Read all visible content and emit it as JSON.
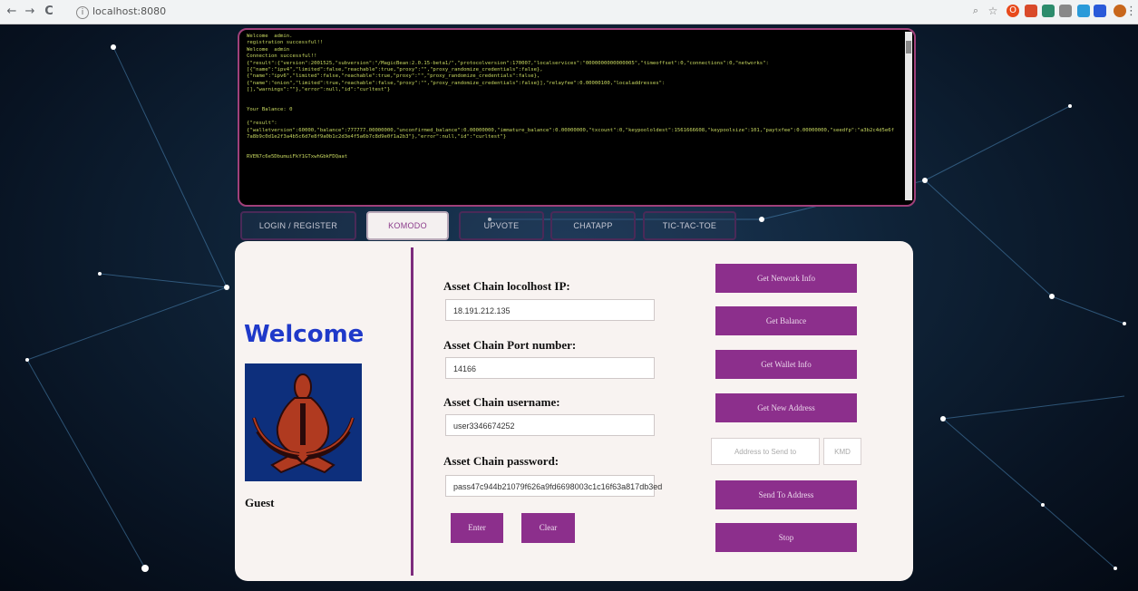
{
  "browser": {
    "url": "localhost:8080",
    "back_icon": "←",
    "forward_icon": "→",
    "reload_icon": "C"
  },
  "console": {
    "lines": "Welcome  admin.\nregistration successful!!\nWelcome  admin\nConnection successful!!\n{\"result\":{\"version\":2001525,\"subversion\":\"/MagicBean:2.0.15-beta1/\",\"protocolversion\":170007,\"localservices\":\"0000000000000005\",\"timeoffset\":0,\"connections\":0,\"networks\":\n[{\"name\":\"ipv4\",\"limited\":false,\"reachable\":true,\"proxy\":\"\",\"proxy_randomize_credentials\":false},\n{\"name\":\"ipv6\",\"limited\":false,\"reachable\":true,\"proxy\":\"\",\"proxy_randomize_credentials\":false},\n{\"name\":\"onion\",\"limited\":true,\"reachable\":false,\"proxy\":\"\",\"proxy_randomize_credentials\":false}],\"relayfee\":0.00000100,\"localaddresses\":\n[],\"warnings\":\"\"},\"error\":null,\"id\":\"curltest\"}\n\n\nYour Balance: 0\n\n{\"result\":\n{\"walletversion\":60000,\"balance\":777777.00000000,\"unconfirmed_balance\":0.00000000,\"immature_balance\":0.00000000,\"txcount\":0,\"keypoololdest\":1561666608,\"keypoolsize\":101,\"paytxfee\":0.00000000,\"seedfp\":\"a3b2c4d5e6f7a8b9c0d1e2f3a4b5c6d7e8f9a0b1c2d3e4f5a6b7c8d9e0f1a2b3\"},\"error\":null,\"id\":\"curltest\"}\n\n\nRVEN7c6e5DbumuiFkY1GTxwhGbkFDQaat"
  },
  "tabs": [
    {
      "label": "LOGIN / REGISTER"
    },
    {
      "label": "KOMODO"
    },
    {
      "label": "UPVOTE"
    },
    {
      "label": "CHATAPP"
    },
    {
      "label": "TIC-TAC-TOE"
    }
  ],
  "profile": {
    "welcome": "Welcome",
    "name": "Guest"
  },
  "form": {
    "ip_label": "Asset Chain locolhost IP:",
    "ip_value": "18.191.212.135",
    "port_label": "Asset Chain Port number:",
    "port_value": "14166",
    "user_label": "Asset Chain username:",
    "user_value": "user3346674252",
    "pass_label": "Asset Chain password:",
    "pass_value": "pass47c944b21079f626a9fd6698003c1c16f63a817db3ed",
    "enter_label": "Enter",
    "clear_label": "Clear"
  },
  "actions": {
    "network_info": "Get Network Info",
    "balance": "Get Balance",
    "wallet_info": "Get Wallet Info",
    "new_address": "Get New Address",
    "address_placeholder": "Address to Send to",
    "kmd_placeholder": "KMD",
    "send": "Send To Address",
    "stop": "Stop"
  },
  "colors": {
    "accent": "#8c2f8c",
    "welcome": "#1f39c9",
    "console_text": "#c8d860",
    "console_border": "#a0407a"
  }
}
